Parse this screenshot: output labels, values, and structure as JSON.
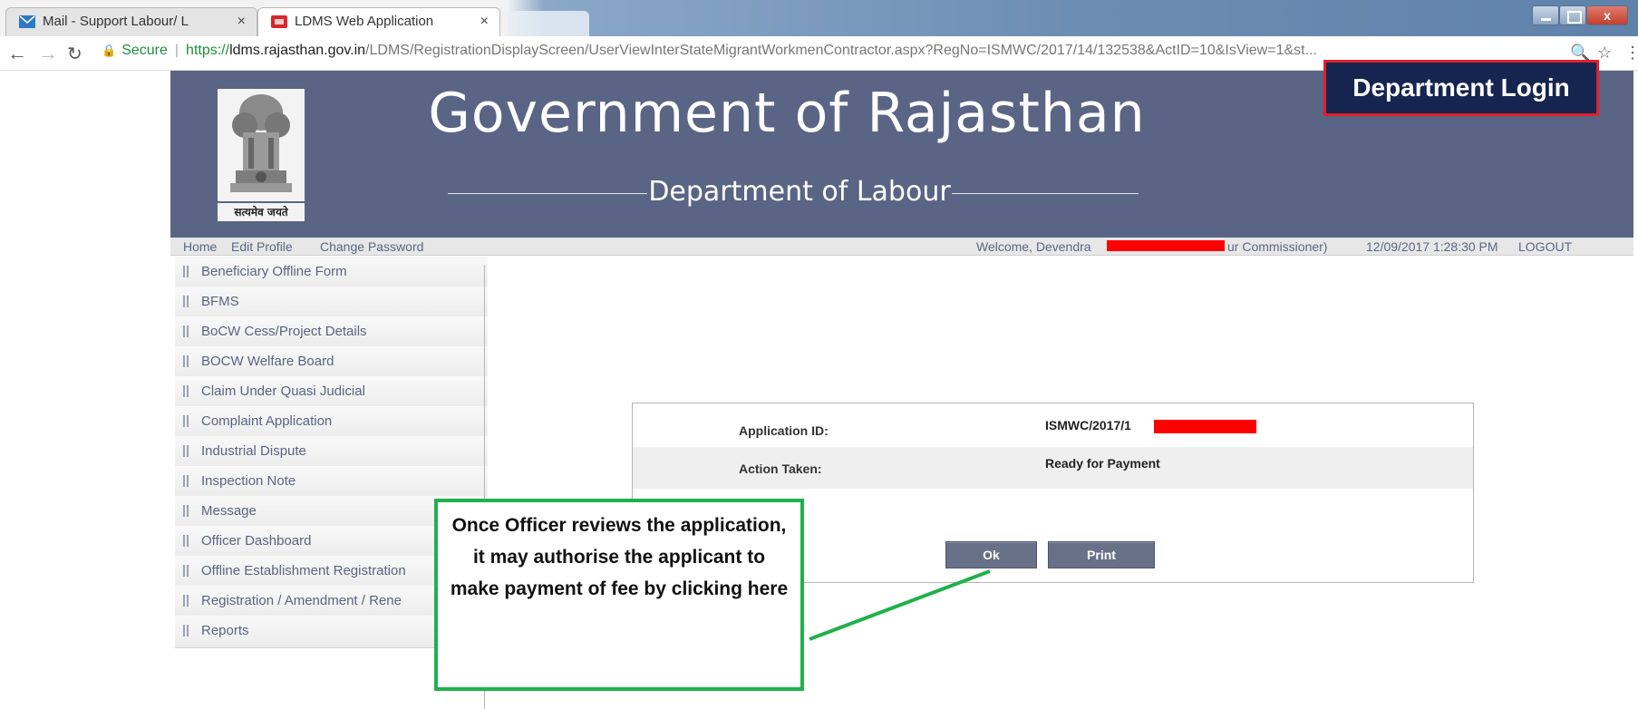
{
  "browser": {
    "tabs": [
      {
        "label": "Mail - Support Labour/ L",
        "close": "×",
        "active": false
      },
      {
        "label": "LDMS Web Application",
        "close": "×",
        "active": true
      }
    ],
    "address": {
      "secure_label": "Secure",
      "protocol": "https://",
      "domain": "ldms.rajasthan.gov.in",
      "path": "/LDMS/RegistrationDisplayScreen/UserViewInterStateMigrantWorkmenContractor.aspx?RegNo=ISMWC/2017/14/132538&ActID=10&IsView=1&st..."
    },
    "window_close": "x"
  },
  "header": {
    "title": "Government of Rajasthan",
    "department": "Department of Labour",
    "emblem_motto": "सत्यमेव जयते",
    "department_login": "Department Login"
  },
  "subnav": {
    "home": "Home",
    "edit_profile": "Edit Profile",
    "change_password": "Change Password",
    "welcome_prefix": "Welcome, Devendra",
    "welcome_suffix": "ur Commissioner)",
    "datetime": "12/09/2017 1:28:30 PM",
    "logout": "LOGOUT"
  },
  "sidebar": {
    "items": [
      {
        "label": "Beneficiary Offline Form"
      },
      {
        "label": "BFMS"
      },
      {
        "label": "BoCW Cess/Project Details"
      },
      {
        "label": "BOCW Welfare Board"
      },
      {
        "label": "Claim Under Quasi Judicial"
      },
      {
        "label": "Complaint Application"
      },
      {
        "label": "Industrial Dispute"
      },
      {
        "label": "Inspection Note"
      },
      {
        "label": "Message"
      },
      {
        "label": "Officer Dashboard"
      },
      {
        "label": "Offline Establishment Registration"
      },
      {
        "label": "Registration / Amendment / Rene"
      },
      {
        "label": "Reports"
      }
    ]
  },
  "result": {
    "application_id_label": "Application ID:",
    "application_id_value": "ISMWC/2017/1",
    "action_taken_label": "Action Taken:",
    "action_taken_value": "Ready for Payment",
    "ok_button": "Ok",
    "print_button": "Print"
  },
  "callout": {
    "text": "Once Officer reviews the application, it may authorise the applicant to make payment of fee by clicking here"
  },
  "colors": {
    "header_bg": "#5a6585",
    "login_bg": "#16254f",
    "login_border": "#e0202a",
    "callout_border": "#1fb14a",
    "button_bg": "#687188",
    "redaction": "#ff0000"
  }
}
